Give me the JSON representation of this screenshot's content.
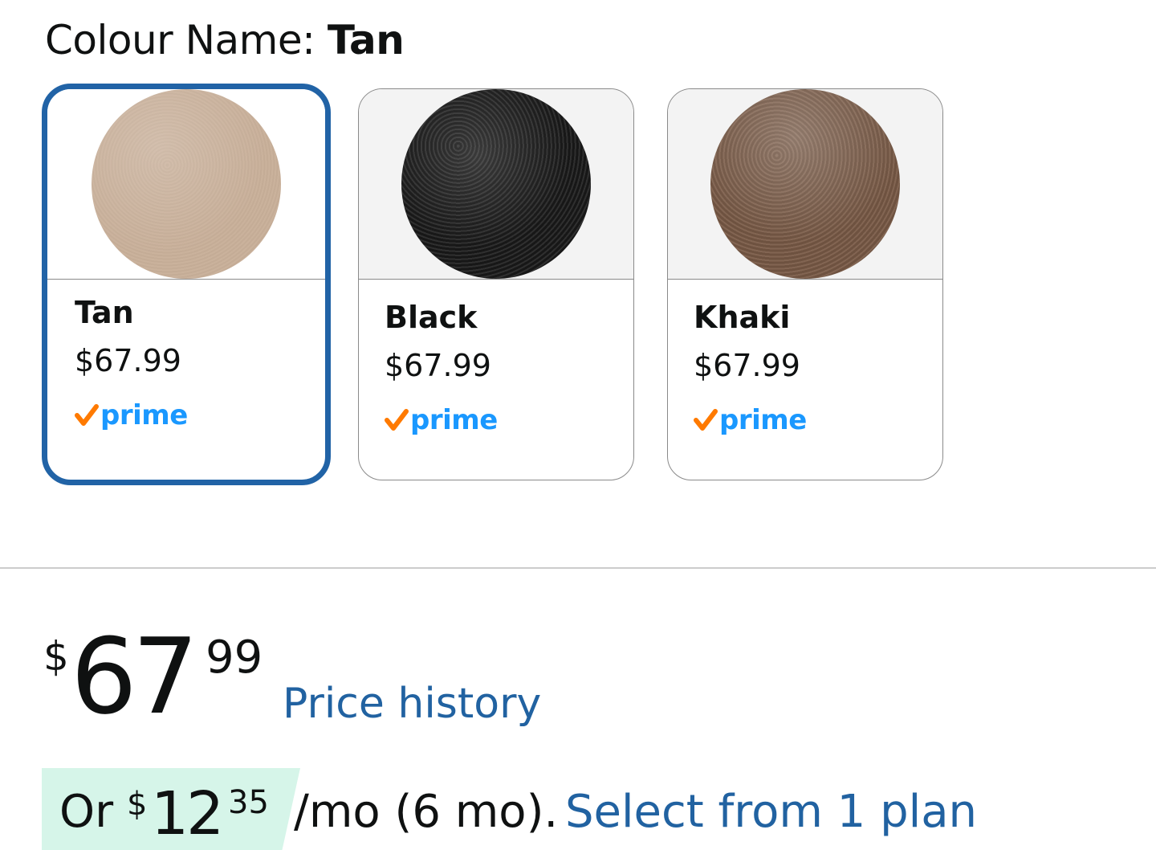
{
  "colour": {
    "label": "Colour Name:",
    "selected": "Tan"
  },
  "swatches": [
    {
      "name": "Tan",
      "price": "$67.99",
      "prime": "prime",
      "selected": true,
      "color": "#c9b09a"
    },
    {
      "name": "Black",
      "price": "$67.99",
      "prime": "prime",
      "selected": false,
      "color": "#1d1d1d"
    },
    {
      "name": "Khaki",
      "price": "$67.99",
      "prime": "prime",
      "selected": false,
      "color": "#7a5b47"
    }
  ],
  "price": {
    "symbol": "$",
    "whole": "67",
    "fraction": "99",
    "history_link": "Price history"
  },
  "installment": {
    "prefix": "Or",
    "symbol": "$",
    "whole": "12",
    "fraction": "35",
    "term": "/mo (6 mo).",
    "link": "Select from 1 plan"
  },
  "colors": {
    "selected_border": "#2163a6",
    "link": "#2162a1",
    "prime_blue": "#1a98ff",
    "prime_check": "#ff7a00",
    "installment_bg": "#d6f5e9"
  }
}
